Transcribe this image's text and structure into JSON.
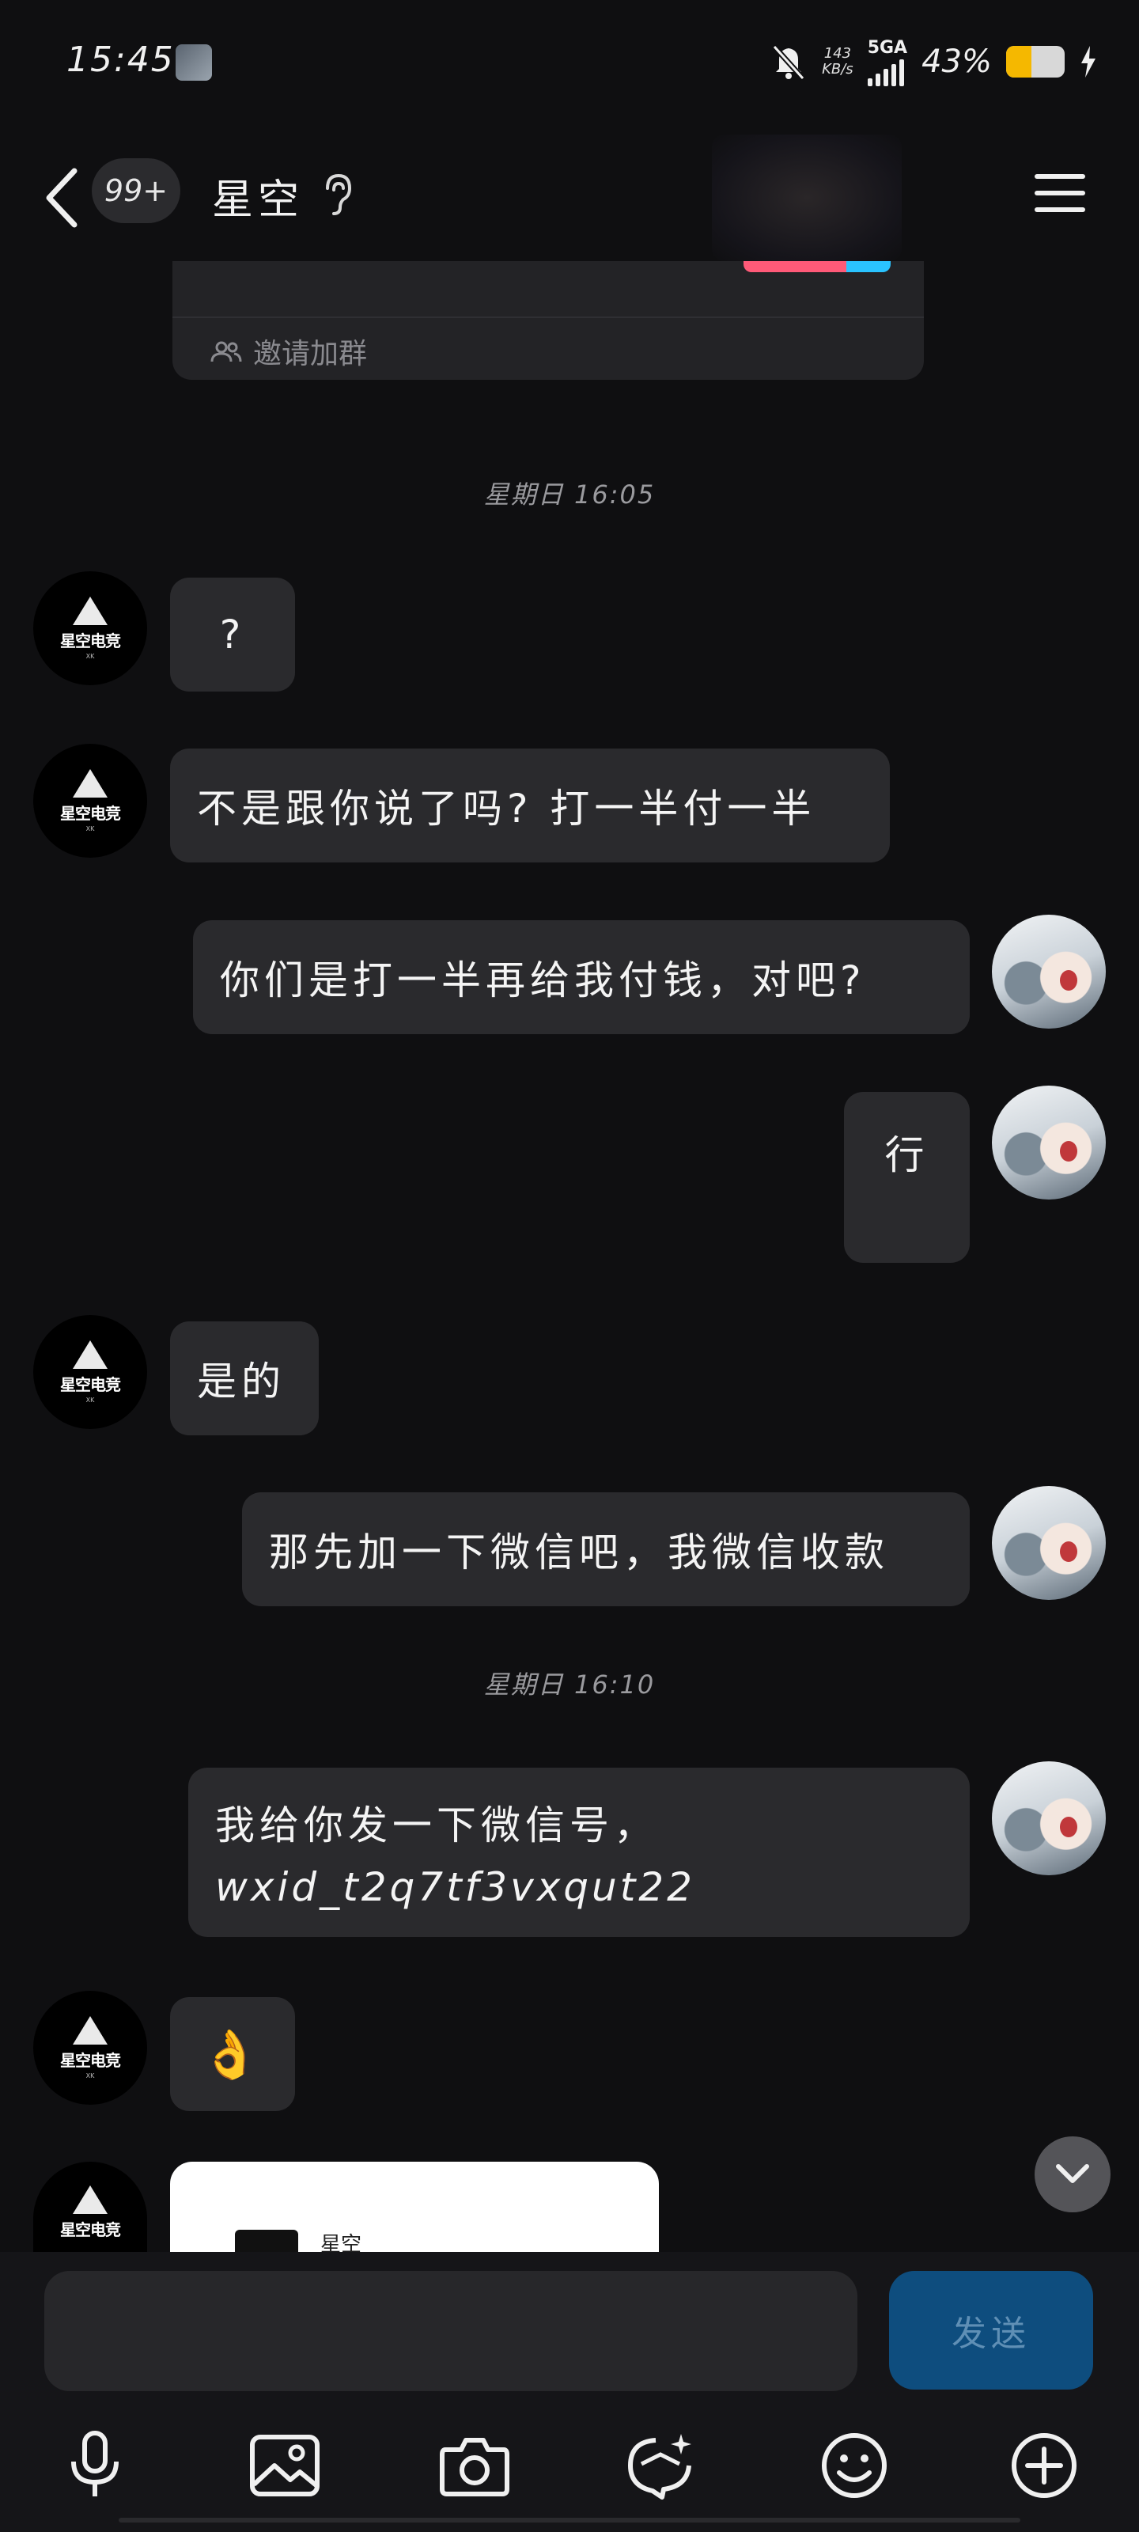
{
  "status_bar": {
    "time": "15:45",
    "net_speed_value": "143",
    "net_speed_unit": "KB/s",
    "network_type": "5GA",
    "battery_percent": "43%",
    "battery_level": 0.43,
    "battery_color": "#f5b800"
  },
  "header": {
    "unread_count": "99+",
    "title": "星空"
  },
  "invite_card": {
    "invite_label": "邀请加群"
  },
  "messages": {
    "time_1": "星期日 16:05",
    "m1": "?",
    "m2": "不是跟你说了吗? 打一半付一半",
    "m3": "你们是打一半再给我付钱，对吧?",
    "m4": "行",
    "m5": "是的",
    "m6": "那先加一下微信吧，我微信收款",
    "time_2": "星期日 16:10",
    "m7_line1": "我给你发一下微信号，",
    "m7_line2": "wxid_t2q7tf3vxqut22",
    "m8": "👌",
    "card_name": "星空"
  },
  "avatars": {
    "brand_text": "星空电竞",
    "brand_sub": "XK"
  },
  "input": {
    "send_label": "发送",
    "placeholder": ""
  },
  "toolbar_icons": [
    "microphone-icon",
    "image-icon",
    "camera-icon",
    "quick-reply-icon",
    "emoji-icon",
    "plus-icon"
  ]
}
